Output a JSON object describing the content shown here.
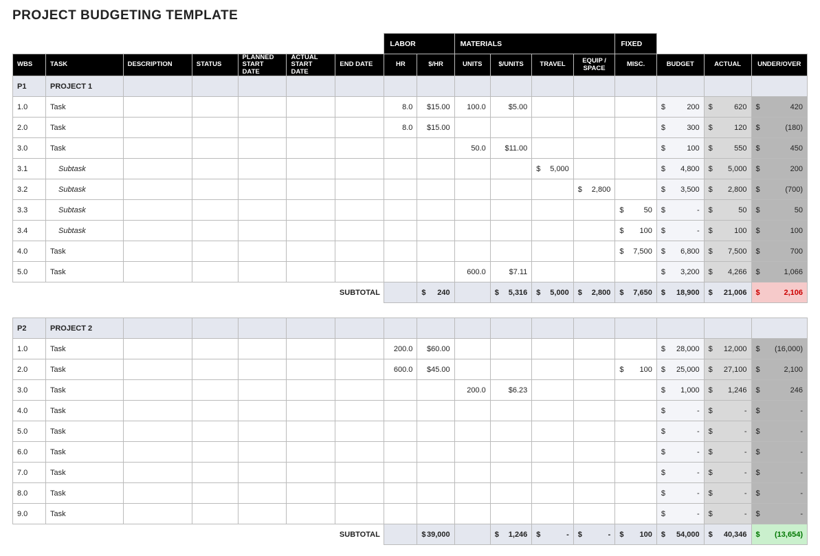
{
  "title": "PROJECT BUDGETING TEMPLATE",
  "group_headers": {
    "labor": "LABOR",
    "materials": "MATERIALS",
    "fixed": "FIXED"
  },
  "headers": {
    "wbs": "WBS",
    "task": "TASK",
    "desc": "DESCRIPTION",
    "status": "STATUS",
    "pstart": "PLANNED START DATE",
    "astart": "ACTUAL START DATE",
    "end": "END DATE",
    "hr": "HR",
    "rate": "$/HR",
    "units": "UNITS",
    "punits": "$/UNITS",
    "travel": "TRAVEL",
    "equip": "EQUIP / SPACE",
    "misc": "MISC.",
    "budget": "BUDGET",
    "actual": "ACTUAL",
    "uo": "UNDER/OVER"
  },
  "subtotal_label": "SUBTOTAL",
  "chart_data": {
    "type": "table",
    "projects": [
      {
        "id": "P1",
        "name": "PROJECT 1",
        "rows": [
          {
            "wbs": "1.0",
            "task": "Task",
            "hr": "8.0",
            "rate": "$15.00",
            "units": "100.0",
            "punits": "$5.00",
            "budget": "200",
            "actual": "620",
            "uo": "420"
          },
          {
            "wbs": "2.0",
            "task": "Task",
            "hr": "8.0",
            "rate": "$15.00",
            "budget": "300",
            "actual": "120",
            "uo": "(180)"
          },
          {
            "wbs": "3.0",
            "task": "Task",
            "units": "50.0",
            "punits": "$11.00",
            "budget": "100",
            "actual": "550",
            "uo": "450"
          },
          {
            "wbs": "3.1",
            "task": "Subtask",
            "indent": true,
            "travel": "5,000",
            "budget": "4,800",
            "actual": "5,000",
            "uo": "200"
          },
          {
            "wbs": "3.2",
            "task": "Subtask",
            "indent": true,
            "equip": "2,800",
            "budget": "3,500",
            "actual": "2,800",
            "uo": "(700)"
          },
          {
            "wbs": "3.3",
            "task": "Subtask",
            "indent": true,
            "misc": "50",
            "budget": "-",
            "actual": "50",
            "uo": "50"
          },
          {
            "wbs": "3.4",
            "task": "Subtask",
            "indent": true,
            "misc": "100",
            "budget": "-",
            "actual": "100",
            "uo": "100"
          },
          {
            "wbs": "4.0",
            "task": "Task",
            "misc": "7,500",
            "budget": "6,800",
            "actual": "7,500",
            "uo": "700"
          },
          {
            "wbs": "5.0",
            "task": "Task",
            "units": "600.0",
            "punits": "$7.11",
            "budget": "3,200",
            "actual": "4,266",
            "uo": "1,066"
          }
        ],
        "subtotal": {
          "rate": "240",
          "punits": "5,316",
          "travel": "5,000",
          "equip": "2,800",
          "misc": "7,650",
          "budget": "18,900",
          "actual": "21,006",
          "uo": "2,106",
          "uo_sign": "neg"
        }
      },
      {
        "id": "P2",
        "name": "PROJECT 2",
        "rows": [
          {
            "wbs": "1.0",
            "task": "Task",
            "hr": "200.0",
            "rate": "$60.00",
            "budget": "28,000",
            "actual": "12,000",
            "uo": "(16,000)"
          },
          {
            "wbs": "2.0",
            "task": "Task",
            "hr": "600.0",
            "rate": "$45.00",
            "misc": "100",
            "budget": "25,000",
            "actual": "27,100",
            "uo": "2,100"
          },
          {
            "wbs": "3.0",
            "task": "Task",
            "units": "200.0",
            "punits": "$6.23",
            "budget": "1,000",
            "actual": "1,246",
            "uo": "246"
          },
          {
            "wbs": "4.0",
            "task": "Task",
            "budget": "-",
            "actual": "-",
            "uo": "-"
          },
          {
            "wbs": "5.0",
            "task": "Task",
            "budget": "-",
            "actual": "-",
            "uo": "-"
          },
          {
            "wbs": "6.0",
            "task": "Task",
            "budget": "-",
            "actual": "-",
            "uo": "-"
          },
          {
            "wbs": "7.0",
            "task": "Task",
            "budget": "-",
            "actual": "-",
            "uo": "-"
          },
          {
            "wbs": "8.0",
            "task": "Task",
            "budget": "-",
            "actual": "-",
            "uo": "-"
          },
          {
            "wbs": "9.0",
            "task": "Task",
            "budget": "-",
            "actual": "-",
            "uo": "-"
          }
        ],
        "subtotal": {
          "rate": "39,000",
          "punits": "1,246",
          "travel": "-",
          "equip": "-",
          "misc": "100",
          "budget": "54,000",
          "actual": "40,346",
          "uo": "(13,654)",
          "uo_sign": "pos"
        }
      }
    ]
  }
}
